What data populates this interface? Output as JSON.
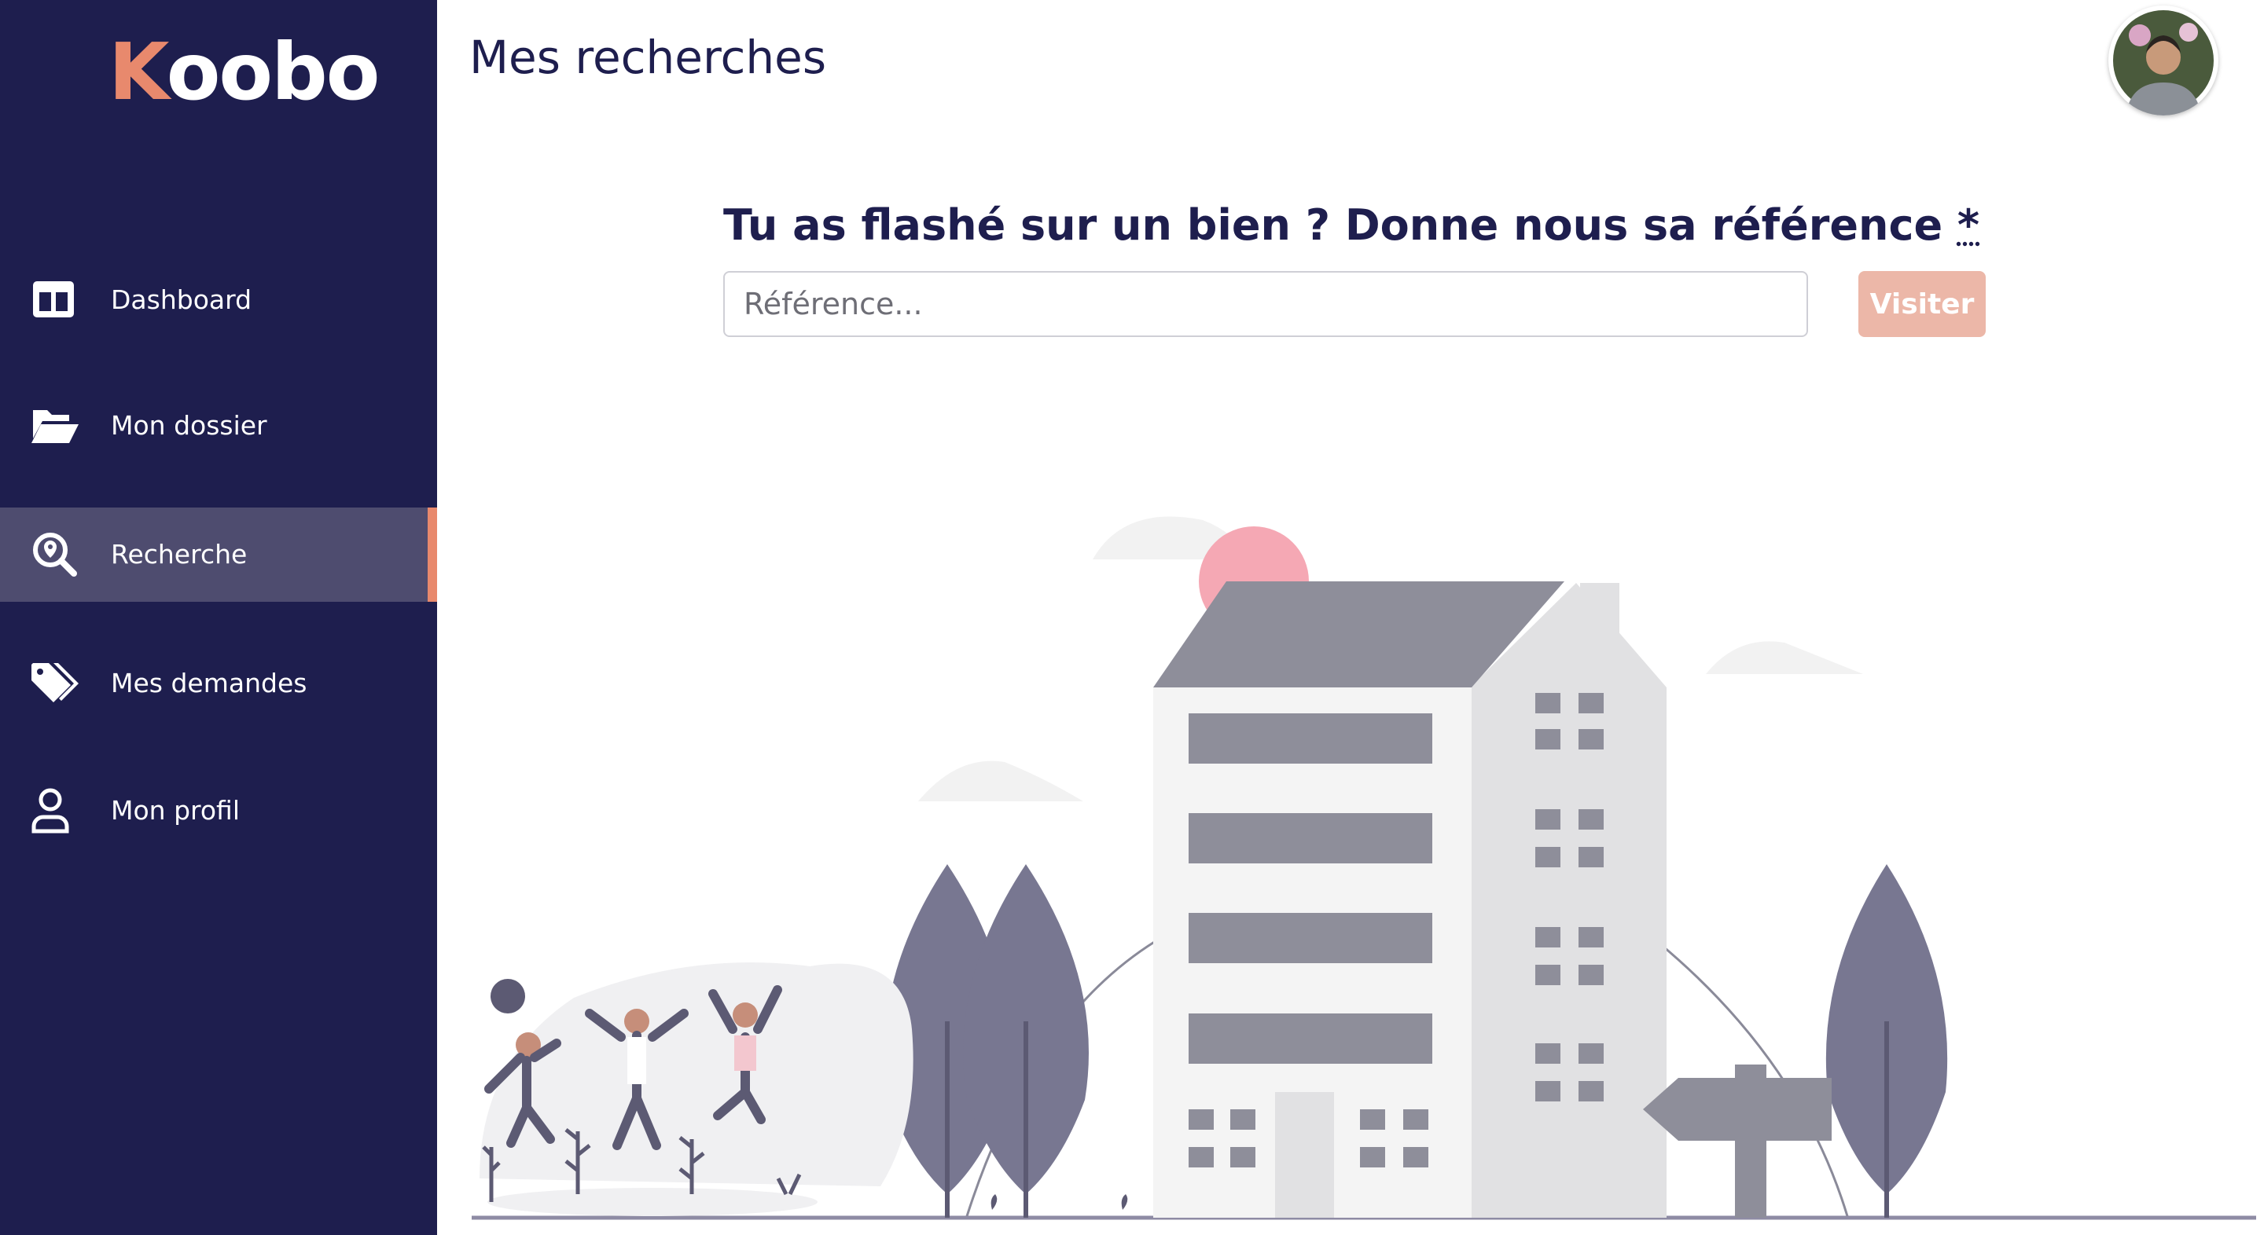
{
  "brand": {
    "logo_first": "K",
    "logo_rest": "oobo",
    "accent": "#e8896d",
    "sidebar_bg": "#1e1e4e"
  },
  "sidebar": {
    "items": [
      {
        "label": "Dashboard",
        "icon": "columns-icon",
        "active": false
      },
      {
        "label": "Mon dossier",
        "icon": "folder-open-icon",
        "active": false
      },
      {
        "label": "Recherche",
        "icon": "search-location-icon",
        "active": true
      },
      {
        "label": "Mes demandes",
        "icon": "tags-icon",
        "active": false
      },
      {
        "label": "Mon profil",
        "icon": "user-icon",
        "active": false
      }
    ]
  },
  "header": {
    "title": "Mes recherches",
    "avatar_icon": "user-avatar"
  },
  "search": {
    "question": "Tu as flashé sur un bien ? Donne nous sa référence",
    "required_mark": "*",
    "placeholder": "Référence...",
    "value": "",
    "button_label": "Visiter",
    "button_color": "#ecb7a8"
  },
  "illustration": {
    "name": "house-search-illustration"
  }
}
